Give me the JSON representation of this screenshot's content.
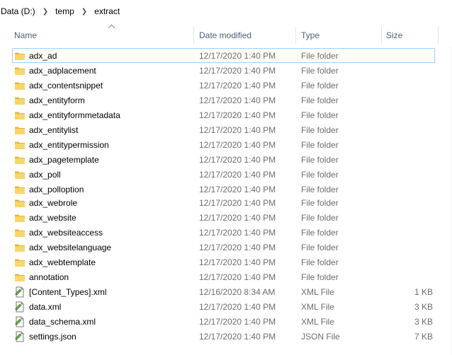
{
  "breadcrumb": [
    "Data (D:)",
    "temp",
    "extract"
  ],
  "columns": {
    "name": "Name",
    "date": "Date modified",
    "type": "Type",
    "size": "Size"
  },
  "colors": {
    "folder": "#f7d66b",
    "folder_dark": "#e4b53e",
    "header_text": "#4c607a",
    "focus_outline": "#99d1ff"
  },
  "rows": [
    {
      "name": "adx_ad",
      "date": "12/17/2020 1:40 PM",
      "type": "File folder",
      "size": "",
      "icon": "folder-icon"
    },
    {
      "name": "adx_adplacement",
      "date": "12/17/2020 1:40 PM",
      "type": "File folder",
      "size": "",
      "icon": "folder-icon"
    },
    {
      "name": "adx_contentsnippet",
      "date": "12/17/2020 1:40 PM",
      "type": "File folder",
      "size": "",
      "icon": "folder-icon"
    },
    {
      "name": "adx_entityform",
      "date": "12/17/2020 1:40 PM",
      "type": "File folder",
      "size": "",
      "icon": "folder-icon"
    },
    {
      "name": "adx_entityformmetadata",
      "date": "12/17/2020 1:40 PM",
      "type": "File folder",
      "size": "",
      "icon": "folder-icon"
    },
    {
      "name": "adx_entitylist",
      "date": "12/17/2020 1:40 PM",
      "type": "File folder",
      "size": "",
      "icon": "folder-icon"
    },
    {
      "name": "adx_entitypermission",
      "date": "12/17/2020 1:40 PM",
      "type": "File folder",
      "size": "",
      "icon": "folder-icon"
    },
    {
      "name": "adx_pagetemplate",
      "date": "12/17/2020 1:40 PM",
      "type": "File folder",
      "size": "",
      "icon": "folder-icon"
    },
    {
      "name": "adx_poll",
      "date": "12/17/2020 1:40 PM",
      "type": "File folder",
      "size": "",
      "icon": "folder-icon"
    },
    {
      "name": "adx_polloption",
      "date": "12/17/2020 1:40 PM",
      "type": "File folder",
      "size": "",
      "icon": "folder-icon"
    },
    {
      "name": "adx_webrole",
      "date": "12/17/2020 1:40 PM",
      "type": "File folder",
      "size": "",
      "icon": "folder-icon"
    },
    {
      "name": "adx_website",
      "date": "12/17/2020 1:40 PM",
      "type": "File folder",
      "size": "",
      "icon": "folder-icon"
    },
    {
      "name": "adx_websiteaccess",
      "date": "12/17/2020 1:40 PM",
      "type": "File folder",
      "size": "",
      "icon": "folder-icon"
    },
    {
      "name": "adx_websitelanguage",
      "date": "12/17/2020 1:40 PM",
      "type": "File folder",
      "size": "",
      "icon": "folder-icon"
    },
    {
      "name": "adx_webtemplate",
      "date": "12/17/2020 1:40 PM",
      "type": "File folder",
      "size": "",
      "icon": "folder-icon"
    },
    {
      "name": "annotation",
      "date": "12/17/2020 1:40 PM",
      "type": "File folder",
      "size": "",
      "icon": "folder-icon"
    },
    {
      "name": "[Content_Types].xml",
      "date": "12/16/2020 8:34 AM",
      "type": "XML File",
      "size": "1 KB",
      "icon": "xml-file-icon"
    },
    {
      "name": "data.xml",
      "date": "12/17/2020 1:40 PM",
      "type": "XML File",
      "size": "3 KB",
      "icon": "xml-file-icon"
    },
    {
      "name": "data_schema.xml",
      "date": "12/17/2020 1:40 PM",
      "type": "XML File",
      "size": "3 KB",
      "icon": "xml-file-icon"
    },
    {
      "name": "settings.json",
      "date": "12/17/2020 1:40 PM",
      "type": "JSON File",
      "size": "7 KB",
      "icon": "json-file-icon"
    }
  ]
}
